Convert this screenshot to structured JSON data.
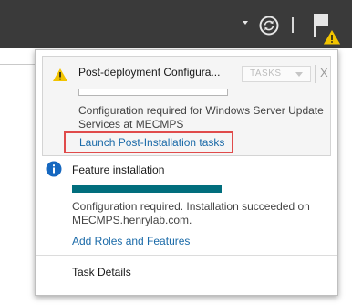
{
  "topbar": {
    "dropdown_icon": "chevron-down-icon",
    "refresh_icon": "refresh-icon",
    "flag_icon": "flag-icon",
    "warning_badge_icon": "warning-icon",
    "colors": {
      "bar": "#3a3a3a",
      "icon": "#e6e6e6",
      "warning": "#f2c400"
    }
  },
  "notifications": {
    "deployment": {
      "icon": "warning-icon",
      "title": "Post-deployment Configura...",
      "tasks_label": "TASKS",
      "close_label": "X",
      "progress_fraction": 0,
      "description": "Configuration required for Windows Server Update Services at MECMPS",
      "link_label": "Launch Post-Installation tasks"
    },
    "feature": {
      "icon": "info-icon",
      "title": "Feature installation",
      "progress_fraction": 1,
      "description": "Configuration required. Installation succeeded on MECMPS.henrylab.com.",
      "link_label": "Add Roles and Features"
    },
    "task_details_label": "Task Details"
  },
  "colors": {
    "link": "#1a6aa8",
    "highlight_box": "#e04b4b",
    "progress": "#016e7d"
  }
}
